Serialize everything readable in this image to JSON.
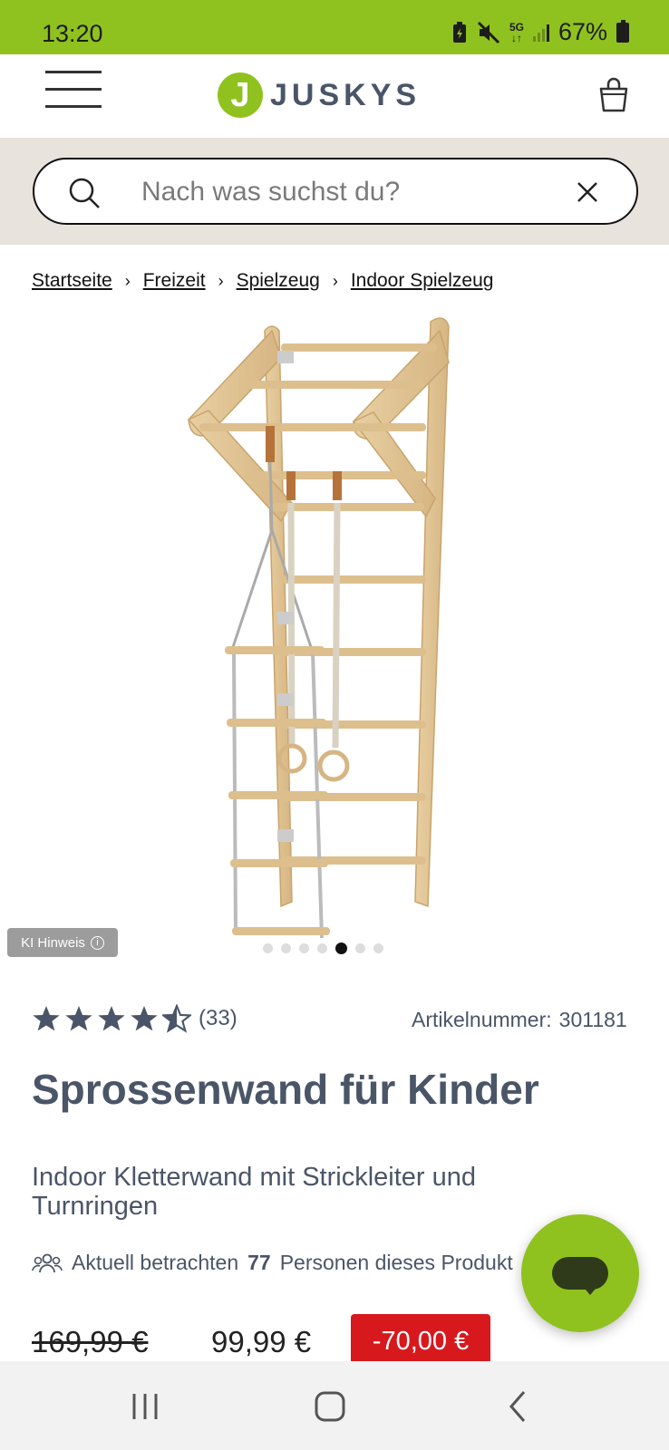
{
  "status_bar": {
    "time": "13:20",
    "network": "5G",
    "battery": "67%"
  },
  "header": {
    "logo_letter": "J",
    "logo_text": "JUSKYS",
    "brand_color": "#8fc21f"
  },
  "search": {
    "placeholder": "Nach was suchst du?"
  },
  "breadcrumb": [
    "Startseite",
    "Freizeit",
    "Spielzeug",
    "Indoor Spielzeug"
  ],
  "image": {
    "ki_badge": "KI Hinweis",
    "dot_count": 7,
    "active_dot": 5
  },
  "product": {
    "rating": 4.5,
    "review_count": "(33)",
    "article_label": "Artikelnummer:",
    "article_number": "301181",
    "title": "Sprossenwand für Kinder",
    "subtitle": "Indoor Kletterwand mit Strickleiter und Turnringen",
    "viewers_prefix": "Aktuell betrachten",
    "viewers_count": "77",
    "viewers_suffix": "Personen dieses Produkt",
    "old_price": "169,99 €",
    "new_price": "99,99 €",
    "discount": "-70,00 €",
    "discount_color": "#d7191e"
  }
}
